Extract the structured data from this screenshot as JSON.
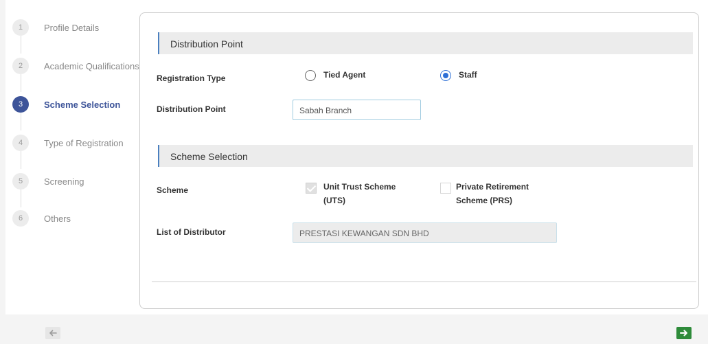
{
  "stepper": {
    "steps": [
      {
        "num": "1",
        "label": "Profile Details"
      },
      {
        "num": "2",
        "label": "Academic Qualifications"
      },
      {
        "num": "3",
        "label": "Scheme Selection"
      },
      {
        "num": "4",
        "label": "Type of Registration"
      },
      {
        "num": "5",
        "label": "Screening"
      },
      {
        "num": "6",
        "label": "Others"
      }
    ],
    "active_step": 3
  },
  "distribution_section": {
    "title": "Distribution Point",
    "registration_type_label": "Registration Type",
    "options": [
      {
        "label": "Tied Agent",
        "selected": false
      },
      {
        "label": "Staff",
        "selected": true
      }
    ],
    "distribution_point_label": "Distribution Point",
    "distribution_point_value": "Sabah Branch"
  },
  "scheme_section": {
    "title": "Scheme Selection",
    "scheme_label": "Scheme",
    "schemes": [
      {
        "line1": "Unit Trust Scheme",
        "line2": "(UTS)",
        "checked": true,
        "disabled": true
      },
      {
        "line1": "Private Retirement",
        "line2": "Scheme (PRS)",
        "checked": false,
        "disabled": true
      }
    ],
    "distributor_label": "List of Distributor",
    "distributor_value": "PRESTASI KEWANGAN SDN BHD"
  },
  "nav": {
    "prev_icon": "arrow-left-icon",
    "next_icon": "arrow-right-icon"
  },
  "colors": {
    "active_step": "#3d5499",
    "section_accent": "#4a7fbf",
    "radio_selected": "#2d6fd6",
    "next_button": "#2e8b3a"
  }
}
